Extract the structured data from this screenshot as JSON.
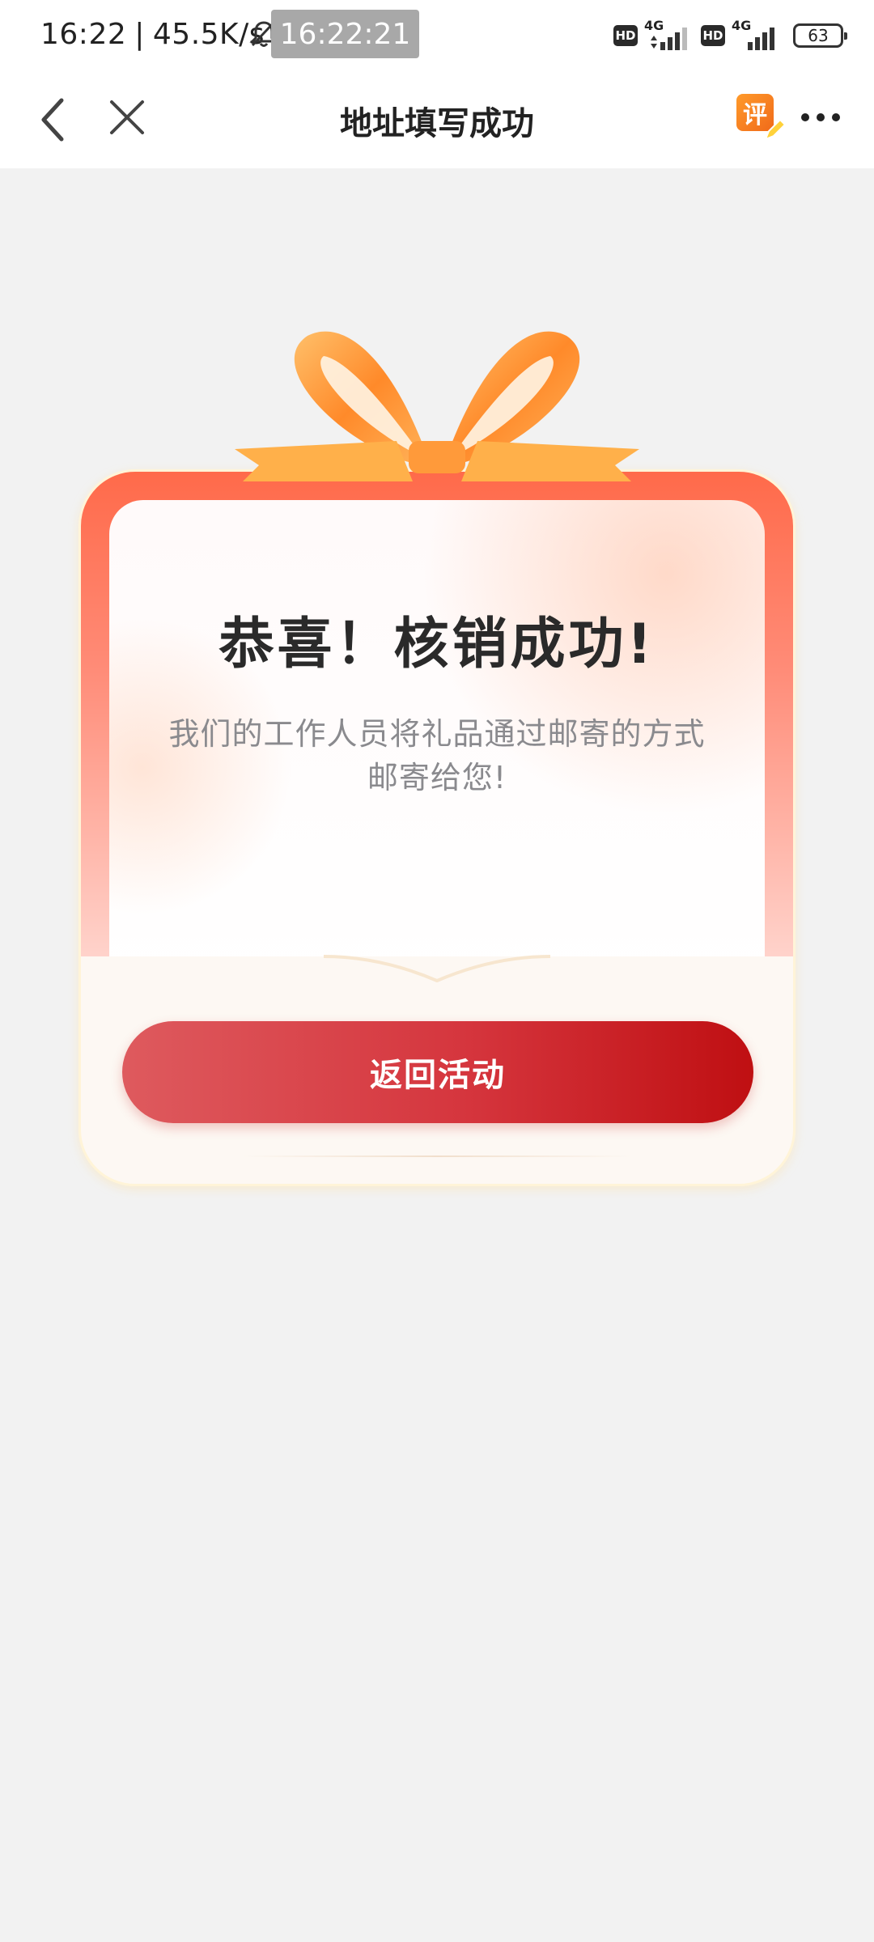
{
  "status_bar": {
    "time": "16:22",
    "separator": "|",
    "speed": "45.5K/s",
    "clock_overlay": "16:22:21",
    "hd_label": "HD",
    "network_label": "4G",
    "battery": "63"
  },
  "nav": {
    "title": "地址填写成功",
    "review_label": "评"
  },
  "card": {
    "title": "恭喜！核销成功!",
    "description": "我们的工作人员将礼品通过邮寄的方式邮寄给您!",
    "button_label": "返回活动"
  },
  "colors": {
    "button_start": "#de5a5e",
    "button_end": "#bf0f12",
    "card_top": "#ff6a4a",
    "bow": "#ff9a3a",
    "background": "#f2f2f2"
  }
}
